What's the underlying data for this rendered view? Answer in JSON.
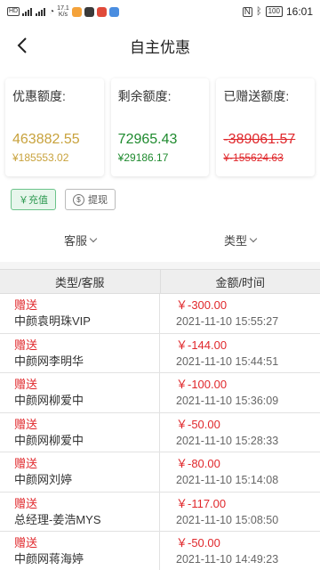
{
  "status_bar": {
    "net_speed": "17.1",
    "net_unit": "K/s",
    "battery": "100",
    "time": "16:01"
  },
  "header": {
    "title": "自主优惠"
  },
  "cards": [
    {
      "label": "优惠额度:",
      "value": "463882.55",
      "sub": "¥185553.02",
      "color": "#c8a23c"
    },
    {
      "label": "剩余额度:",
      "value": "72965.43",
      "sub": "¥29186.17",
      "color": "#1e8a2e"
    },
    {
      "label": "已赠送额度:",
      "value": "-389061.57",
      "sub": "¥-155624.63",
      "color": "#e0282c"
    }
  ],
  "actions": {
    "recharge_label": "￥充值",
    "withdraw_label": "提现"
  },
  "filters": {
    "service_label": "客服",
    "type_label": "类型"
  },
  "table": {
    "headers": [
      "类型/客服",
      "金额/时间"
    ],
    "rows": [
      {
        "type": "赠送",
        "name": "中颜袁明珠VIP",
        "amount": "￥-300.00",
        "time": "2021-11-10 15:55:27"
      },
      {
        "type": "赠送",
        "name": "中颜网李明华",
        "amount": "￥-144.00",
        "time": "2021-11-10 15:44:51"
      },
      {
        "type": "赠送",
        "name": "中颜网柳爱中",
        "amount": "￥-100.00",
        "time": "2021-11-10 15:36:09"
      },
      {
        "type": "赠送",
        "name": "中颜网柳爱中",
        "amount": "￥-50.00",
        "time": "2021-11-10 15:28:33"
      },
      {
        "type": "赠送",
        "name": "中颜网刘婷",
        "amount": "￥-80.00",
        "time": "2021-11-10 15:14:08"
      },
      {
        "type": "赠送",
        "name": "总经理-姜浩MYS",
        "amount": "￥-117.00",
        "time": "2021-11-10 15:08:50"
      },
      {
        "type": "赠送",
        "name": "中颜网蒋海婷",
        "amount": "￥-50.00",
        "time": "2021-11-10 14:49:23"
      }
    ]
  }
}
